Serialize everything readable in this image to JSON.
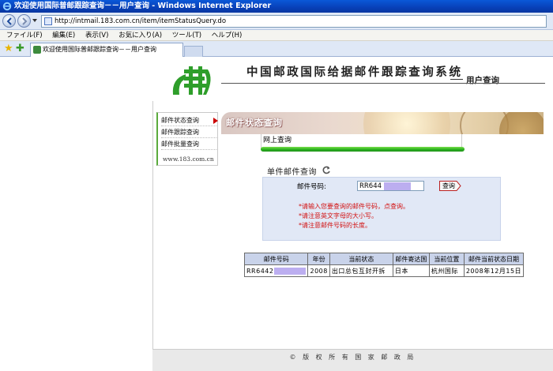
{
  "window": {
    "title": "欢迎使用国际普邮跟踪查询－－用户查询 - Windows Internet Explorer",
    "url": "http://intmail.183.com.cn/item/itemStatusQuery.do"
  },
  "menu": [
    "ファイル(F)",
    "編集(E)",
    "表示(V)",
    "お気に入り(A)",
    "ツール(T)",
    "ヘルプ(H)"
  ],
  "tab": {
    "label": "欢迎使用国际普邮跟踪查询－－用户查询"
  },
  "header": {
    "title": "中国邮政国际给据邮件跟踪查询系统",
    "subtitle": "用户查询"
  },
  "sidebar": {
    "items": [
      {
        "label": "邮件状态查询"
      },
      {
        "label": "邮件跟踪查询"
      },
      {
        "label": "邮件批量查询"
      }
    ],
    "url": "www.183.com.cn"
  },
  "section": {
    "banner_title": "邮件状态查询",
    "online_query": "网上查询",
    "single_query": "单件邮件查询"
  },
  "form": {
    "code_label": "邮件号码:",
    "code_value": "RR644",
    "submit_label": "查询",
    "hints": [
      "*请输入您要查询的邮件号码，点查询。",
      "*请注意英文字母的大小写。",
      "*请注意邮件号码的长度。"
    ]
  },
  "table": {
    "headers": [
      "邮件号码",
      "年份",
      "当前状态",
      "邮件寄达国",
      "当前位置",
      "邮件当前状态日期"
    ],
    "row": {
      "code": "RR6442",
      "year": "2008",
      "status": "出口总包互封开拆",
      "destination": "日本",
      "location": "杭州国际",
      "date": "2008年12月15日"
    }
  },
  "footer": "© 版 权 所 有 国 家 邮 政 局",
  "colors": {
    "accent_green": "#2ab020",
    "hint_red": "#d21212",
    "panel_blue": "#e1e8f6"
  }
}
